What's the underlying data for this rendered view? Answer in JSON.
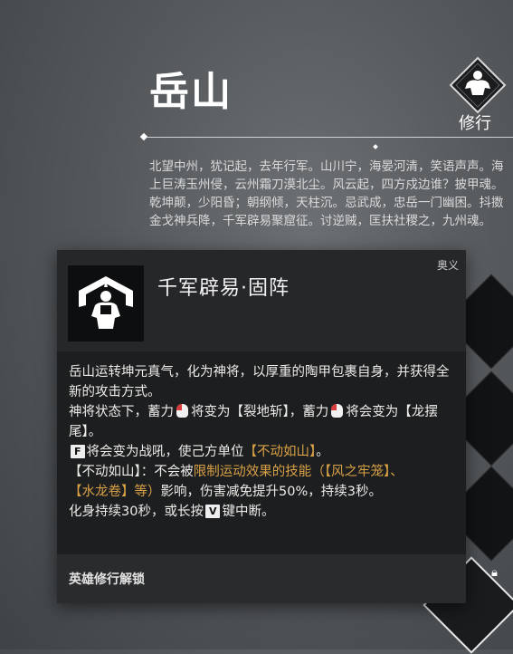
{
  "hero": {
    "name": "岳山",
    "practice_label": "修行",
    "lore": [
      "北望中州，犹记起，去年行军。山川宁，海晏河清，笑语声声。海上巨涛玉州侵，云州霜刀漠北尘。风云起，四方戍边谁？披甲魂。",
      "乾坤颠，少阳昏；朝纲倾，天柱沉。忌武成，忠岳一门幽困。抖擞金戈神兵降，千军辟易聚窟征。讨逆贼，匡扶社稷之，九州魂。"
    ]
  },
  "tooltip": {
    "skill_name": "千军辟易·固阵",
    "skill_type": "奥义",
    "desc": {
      "p1": "岳山运转坤元真气，化为神将，以厚重的陶甲包裹自身，并获得全新的攻击方式。",
      "p2_a": "神将状态下，蓄力",
      "p2_b": "将变为【裂地斩】，蓄力",
      "p2_c": "将会变为【龙摆尾】。",
      "key_f": "F",
      "p3_a": "将会变为战吼，使己方单位",
      "p3_hl": "【不动如山】",
      "p3_b": "。",
      "p4_a": "【不动如山】：不会被",
      "p4_hl1": "限制运动效果的技能（",
      "p4_hl2": "【风之牢笼】",
      "p4_sep": "、",
      "p4_hl3": "【水龙卷】",
      "p4_hl4": "等）",
      "p4_b": "影响，伤害减免提升50%，持续3秒。",
      "p5_a": "化身持续30秒，或长按",
      "key_v": "V",
      "p5_b": "键中断。"
    },
    "unlock": "英雄修行解锁"
  },
  "icons": {
    "practice": "muscle-figure-icon",
    "skill": "armored-general-icon",
    "mouse": "mouse-right-click-icon",
    "check": "checkmark-icon",
    "lock": "lock-icon",
    "refresh": "refresh-icon"
  },
  "colors": {
    "highlight": "#d9a145",
    "tooltip_bg": "#1d1e20"
  }
}
